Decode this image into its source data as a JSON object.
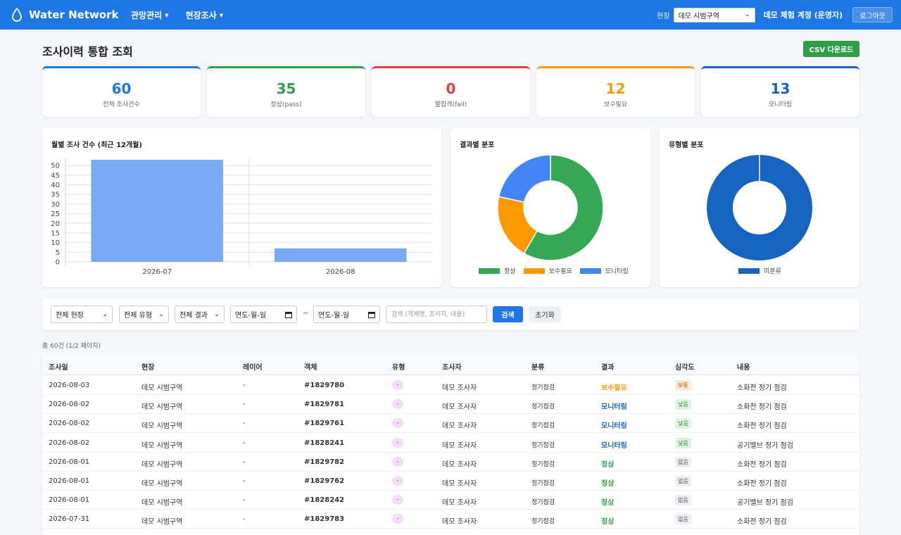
{
  "header": {
    "brand": "Water Network",
    "nav": [
      {
        "label": "관망관리"
      },
      {
        "label": "현장조사"
      }
    ],
    "site_label": "현장",
    "site_value": "데모 시범구역",
    "account": "데모 체험 계정 (운영자)",
    "logout": "로그아웃"
  },
  "page": {
    "title": "조사이력 통합 조회",
    "csv_button": "CSV 다운로드"
  },
  "stats": [
    {
      "value": "60",
      "label": "전체 조사건수",
      "color": "#1f77e5"
    },
    {
      "value": "35",
      "label": "정상(pass)",
      "color": "#2e9e49"
    },
    {
      "value": "0",
      "label": "불합격(fail)",
      "color": "#e0413a"
    },
    {
      "value": "12",
      "label": "보수필요",
      "color": "#f39c12"
    },
    {
      "value": "13",
      "label": "모니터링",
      "color": "#1a5fc4"
    }
  ],
  "charts": {
    "monthly_title": "월별 조사 건수 (최근 12개월)",
    "result_title": "결과별 분포",
    "type_title": "유형별 분포"
  },
  "chart_data": [
    {
      "type": "bar",
      "title": "월별 조사 건수 (최근 12개월)",
      "categories": [
        "2026-07",
        "2026-08"
      ],
      "values": [
        53,
        7
      ],
      "ylim": [
        0,
        53
      ],
      "yticks": [
        0,
        5,
        10,
        15,
        20,
        25,
        30,
        35,
        40,
        45,
        50
      ],
      "color": "#7aa9f5",
      "grid": true
    },
    {
      "type": "pie",
      "title": "결과별 분포",
      "labels": [
        "정상",
        "보수필요",
        "모니터링"
      ],
      "values": [
        35,
        12,
        13
      ],
      "colors": [
        "#34a853",
        "#ff9800",
        "#4285f4"
      ],
      "legend": "bottom"
    },
    {
      "type": "pie",
      "title": "유형별 분포",
      "labels": [
        "미분류"
      ],
      "values": [
        60
      ],
      "colors": [
        "#1565c0"
      ],
      "legend": "bottom"
    }
  ],
  "filters": {
    "site": "전체 현장",
    "type": "전체 유형",
    "result": "전체 결과",
    "date_from": "연도-월-일",
    "date_to": "연도-월-일",
    "tilde": "~",
    "search_placeholder": "검색 (객체명, 조사자, 내용)",
    "search_button": "검색",
    "reset_button": "초기화"
  },
  "table": {
    "total": "총 60건 (1/2 페이지)",
    "columns": [
      "조사일",
      "현장",
      "레이어",
      "객체",
      "유형",
      "조사자",
      "분류",
      "결과",
      "심각도",
      "내용"
    ],
    "rows": [
      {
        "date": "2026-08-03",
        "site": "데모 시범구역",
        "layer": "-",
        "object": "#1829780",
        "type": "-",
        "inspector": "데모 조사자",
        "category": "정기점검",
        "result": "보수필요",
        "severity": "보통",
        "content": "소화전 정기 점검"
      },
      {
        "date": "2026-08-02",
        "site": "데모 시범구역",
        "layer": "-",
        "object": "#1829781",
        "type": "-",
        "inspector": "데모 조사자",
        "category": "정기점검",
        "result": "모니터링",
        "severity": "낮음",
        "content": "소화전 정기 점검"
      },
      {
        "date": "2026-08-02",
        "site": "데모 시범구역",
        "layer": "-",
        "object": "#1829761",
        "type": "-",
        "inspector": "데모 조사자",
        "category": "정기점검",
        "result": "모니터링",
        "severity": "낮음",
        "content": "소화전 정기 점검"
      },
      {
        "date": "2026-08-02",
        "site": "데모 시범구역",
        "layer": "-",
        "object": "#1828241",
        "type": "-",
        "inspector": "데모 조사자",
        "category": "정기점검",
        "result": "모니터링",
        "severity": "낮음",
        "content": "공기밸브 정기 점검"
      },
      {
        "date": "2026-08-01",
        "site": "데모 시범구역",
        "layer": "-",
        "object": "#1829782",
        "type": "-",
        "inspector": "데모 조사자",
        "category": "정기점검",
        "result": "정상",
        "severity": "없음",
        "content": "소화전 정기 점검"
      },
      {
        "date": "2026-08-01",
        "site": "데모 시범구역",
        "layer": "-",
        "object": "#1829762",
        "type": "-",
        "inspector": "데모 조사자",
        "category": "정기점검",
        "result": "정상",
        "severity": "없음",
        "content": "소화전 정기 점검"
      },
      {
        "date": "2026-08-01",
        "site": "데모 시범구역",
        "layer": "-",
        "object": "#1828242",
        "type": "-",
        "inspector": "데모 조사자",
        "category": "정기점검",
        "result": "정상",
        "severity": "없음",
        "content": "공기밸브 정기 점검"
      },
      {
        "date": "2026-07-31",
        "site": "데모 시범구역",
        "layer": "-",
        "object": "#1829783",
        "type": "-",
        "inspector": "데모 조사자",
        "category": "정기점검",
        "result": "정상",
        "severity": "없음",
        "content": "소화전 정기 점검"
      }
    ]
  },
  "colors": {
    "primary": "#1f77e5",
    "result_repair": "#f39c12",
    "result_monitor": "#1a5fc4",
    "result_pass": "#2e9e49"
  }
}
